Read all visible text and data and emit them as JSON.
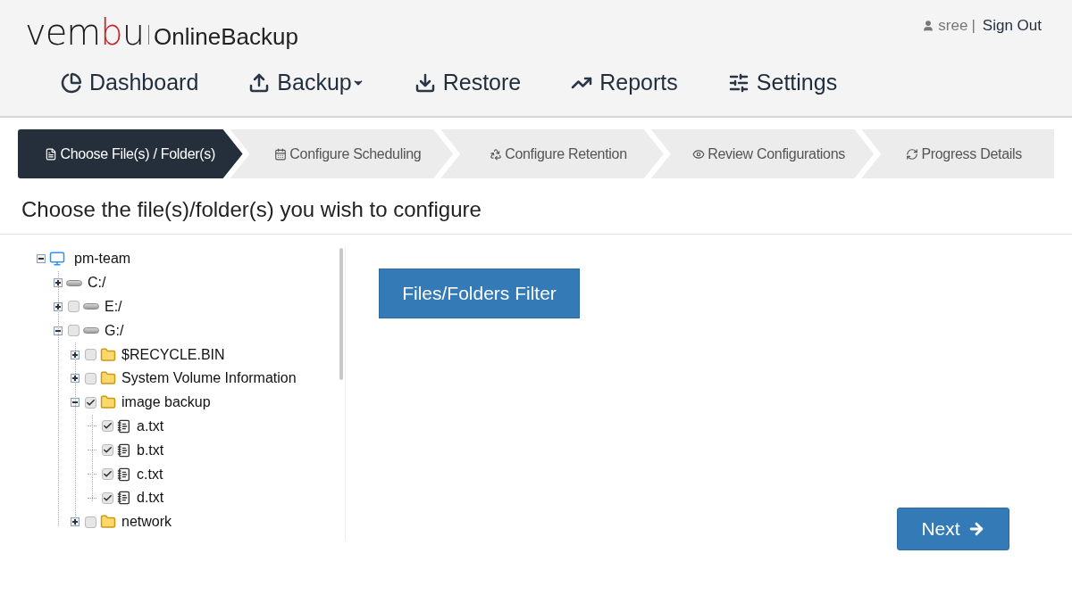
{
  "header": {
    "logo": {
      "parts": [
        {
          "text": "vem",
          "color": "#1a1a1a"
        },
        {
          "text": "b",
          "color": "#c1272d"
        },
        {
          "text": "u",
          "color": "#1a1a1a"
        }
      ],
      "product": "OnlineBackup"
    },
    "user": "sree",
    "separator": "|",
    "sign_out": "Sign Out"
  },
  "nav": [
    {
      "label": "Dashboard",
      "dropdown": false
    },
    {
      "label": "Backup",
      "dropdown": true
    },
    {
      "label": "Restore",
      "dropdown": false
    },
    {
      "label": "Reports",
      "dropdown": false
    },
    {
      "label": "Settings",
      "dropdown": false
    }
  ],
  "steps": [
    {
      "label": "Choose File(s) / Folder(s)",
      "selected": true
    },
    {
      "label": "Configure Scheduling",
      "selected": false
    },
    {
      "label": "Configure Retention",
      "selected": false
    },
    {
      "label": "Review Configurations",
      "selected": false
    },
    {
      "label": "Progress Details",
      "selected": false
    }
  ],
  "heading": "Choose the file(s)/folder(s) you wish to configure",
  "tree": [
    {
      "label": "pm-team",
      "kind": "computer",
      "expanded": true,
      "children": [
        {
          "label": "C:/",
          "kind": "drive",
          "expanded": false
        },
        {
          "label": "E:/",
          "kind": "drive",
          "expanded": false,
          "checked": false
        },
        {
          "label": "G:/",
          "kind": "drive",
          "expanded": true,
          "checked": false,
          "children": [
            {
              "label": "$RECYCLE.BIN",
              "kind": "folder",
              "expanded": false,
              "checked": false
            },
            {
              "label": "System Volume Information",
              "kind": "folder",
              "expanded": false,
              "checked": false
            },
            {
              "label": "image backup",
              "kind": "folder",
              "expanded": true,
              "checked": true,
              "children": [
                {
                  "label": "a.txt",
                  "kind": "file",
                  "checked": true
                },
                {
                  "label": "b.txt",
                  "kind": "file",
                  "checked": true
                },
                {
                  "label": "c.txt",
                  "kind": "file",
                  "checked": true
                },
                {
                  "label": "d.txt",
                  "kind": "file",
                  "checked": true
                }
              ]
            },
            {
              "label": "network",
              "kind": "folder",
              "expanded": false,
              "checked": false
            }
          ]
        }
      ]
    }
  ],
  "filter_button": "Files/Folders Filter",
  "next_button": "Next"
}
